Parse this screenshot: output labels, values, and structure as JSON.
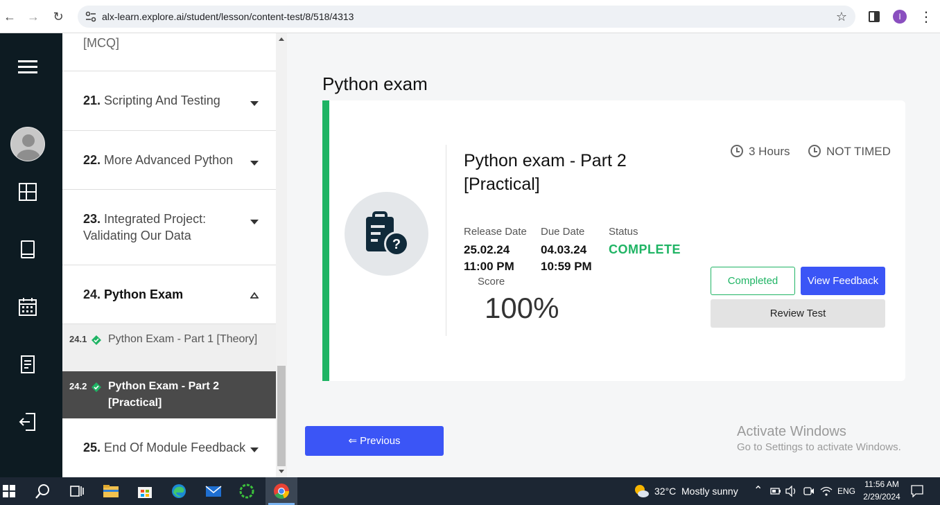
{
  "browser": {
    "url": "alx-learn.explore.ai/student/lesson/content-test/8/518/4313",
    "profile_initial": "I"
  },
  "rail": {
    "icons": [
      "hamburger-icon",
      "avatar",
      "dashboard-icon",
      "book-icon",
      "calendar-icon",
      "document-icon",
      "logout-icon"
    ]
  },
  "course_list": {
    "partial_top": "[MCQ]",
    "items": [
      {
        "num": "21.",
        "label": "Scripting And Testing"
      },
      {
        "num": "22.",
        "label": "More Advanced Python"
      },
      {
        "num": "23.",
        "label": "Integrated Project: Validating Our Data"
      },
      {
        "num": "24.",
        "label": "Python Exam"
      },
      {
        "num": "25.",
        "label": "End Of Module Feedback"
      }
    ],
    "subitems": [
      {
        "num": "24.1",
        "title": "Python Exam - Part 1 [Theory]"
      },
      {
        "num": "24.2",
        "title": "Python Exam - Part 2 [Practical]"
      }
    ]
  },
  "main": {
    "page_title": "Python exam",
    "exam_title": "Python exam - Part 2 [Practical]",
    "duration": "3 Hours",
    "timed": "NOT TIMED",
    "release_label": "Release Date",
    "release_date": "25.02.24",
    "release_time": "11:00 PM",
    "due_label": "Due Date",
    "due_date": "04.03.24",
    "due_time": "10:59 PM",
    "status_label": "Status",
    "status_value": "COMPLETE",
    "score_label": "Score",
    "score_value": "100%",
    "btn_completed": "Completed",
    "btn_feedback": "View Feedback",
    "btn_review": "Review Test",
    "btn_previous": "⇐ Previous",
    "activate_title": "Activate Windows",
    "activate_sub": "Go to Settings to activate Windows."
  },
  "taskbar": {
    "weather_temp": "32°C",
    "weather_text": "Mostly sunny",
    "lang": "ENG",
    "time": "11:56 AM",
    "date": "2/29/2024"
  },
  "colors": {
    "accent_green": "#1fb464",
    "accent_blue": "#3b55f6",
    "rail_bg": "#0d1b22",
    "active_item_bg": "#4a4a4a"
  }
}
